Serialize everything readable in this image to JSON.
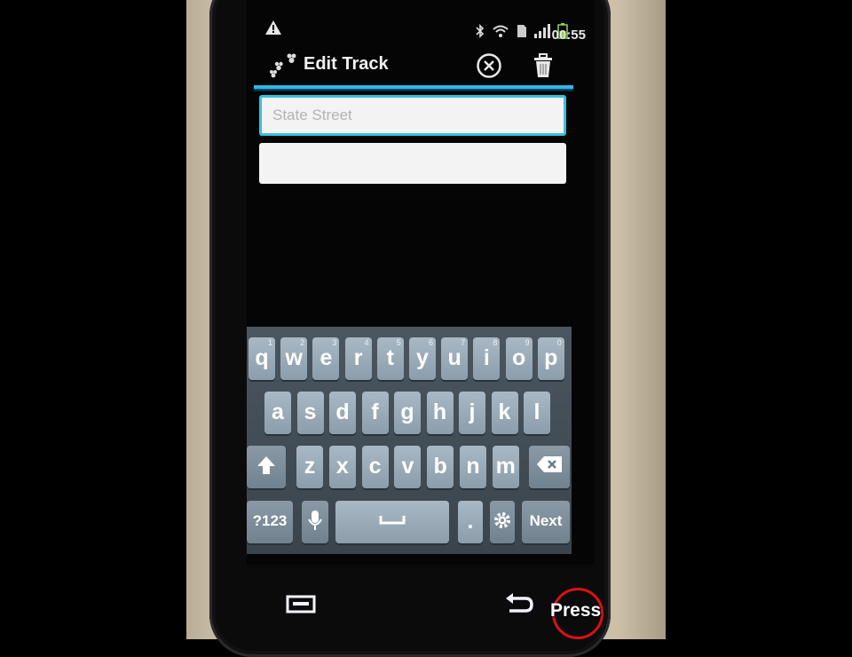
{
  "status_bar": {
    "icons": [
      "warning-icon",
      "bluetooth-icon",
      "wifi-icon",
      "sd-card-icon",
      "signal-icon",
      "battery-icon"
    ],
    "time": "00:55"
  },
  "titlebar": {
    "title": "Edit Track",
    "logo_icon": "paw-prints-icon",
    "actions": [
      "cancel-icon",
      "trash-icon"
    ]
  },
  "form": {
    "field1": {
      "value": "",
      "placeholder": "State Street"
    },
    "field2": {
      "value": "",
      "placeholder": ""
    }
  },
  "keyboard": {
    "row1": [
      {
        "label": "q",
        "hint": "1"
      },
      {
        "label": "w",
        "hint": "2"
      },
      {
        "label": "e",
        "hint": "3"
      },
      {
        "label": "r",
        "hint": "4"
      },
      {
        "label": "t",
        "hint": "5"
      },
      {
        "label": "y",
        "hint": "6"
      },
      {
        "label": "u",
        "hint": "7"
      },
      {
        "label": "i",
        "hint": "8"
      },
      {
        "label": "o",
        "hint": "9"
      },
      {
        "label": "p",
        "hint": "0"
      }
    ],
    "row2": [
      "a",
      "s",
      "d",
      "f",
      "g",
      "h",
      "j",
      "k",
      "l"
    ],
    "row3": [
      "z",
      "x",
      "c",
      "v",
      "b",
      "n",
      "m"
    ],
    "row4": {
      "symbols": "?123",
      "period": ".",
      "next": "Next"
    },
    "icons": [
      "shift-icon",
      "backspace-icon",
      "mic-icon",
      "space-icon",
      "settings-icon"
    ]
  },
  "hardware": {
    "menu_icon": "menu-icon",
    "back_icon": "back-icon",
    "annotation": "Press",
    "annotation_color": "#dd1111"
  },
  "colors": {
    "accent": "#33b5e5"
  }
}
